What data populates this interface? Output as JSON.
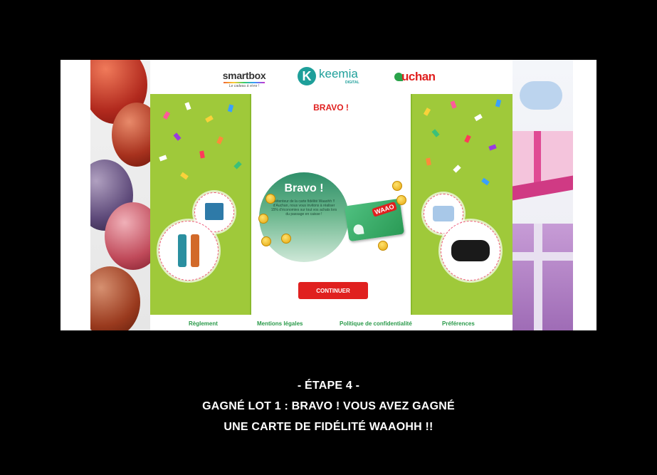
{
  "header": {
    "smartbox": {
      "name": "smartbox",
      "tagline": "Le cadeau à vivre !"
    },
    "keemia": {
      "initial": "K",
      "name": "keemia",
      "sub": "DIGITAL"
    },
    "auchan": {
      "name": "uchan"
    }
  },
  "main": {
    "title": "BRAVO !",
    "badge_title": "Bravo !",
    "badge_text": "Détenteur de la carte fidélité Waaohh !! d’Auchan, nous vous invitons à réaliser 15% d’économies sur tout vos achats lors du passage en caisse !",
    "card_logo": "WAAO",
    "cta_label": "CONTINUER"
  },
  "footer": {
    "links": [
      "Règlement",
      "Mentions légales",
      "Politique de confidentialité",
      "Préférences"
    ]
  },
  "caption": {
    "line1": "- ÉTAPE 4 -",
    "line2": "GAGNÉ LOT 1 : BRAVO ! VOUS AVEZ GAGNÉ",
    "line3": "UNE CARTE DE FIDÉLITÉ WAAOHH !!"
  },
  "colors": {
    "accent_red": "#e0201f",
    "panel_green": "#9fc93a",
    "link_green": "#2a9a4a",
    "keemia_teal": "#1e9f9a"
  },
  "icons": [
    "balloon-image",
    "gift-box-image",
    "tote-bag-prize",
    "thermos-prize",
    "sweatshirt-prize",
    "speaker-prize",
    "coin-icon"
  ]
}
